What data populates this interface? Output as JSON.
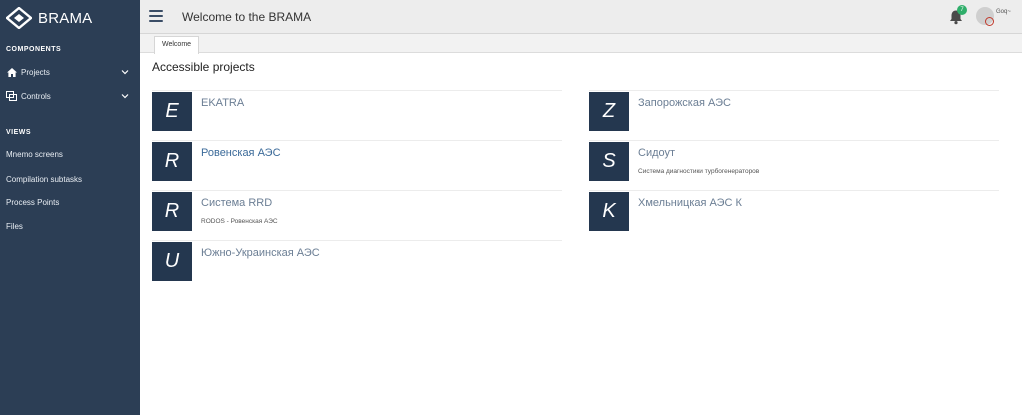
{
  "sidebar": {
    "brand": "BRAMA",
    "components_title": "COMPONENTS",
    "projects_label": "Projects",
    "controls_label": "Controls",
    "views_title": "VIEWS",
    "views": [
      "Mnemo screens",
      "Compilation subtasks",
      "Process Points",
      "Files"
    ]
  },
  "header": {
    "title": "Welcome to the BRAMA",
    "notification_count": "7",
    "user_name": "Goq~"
  },
  "tabs": [
    "Welcome"
  ],
  "main": {
    "title": "Accessible projects",
    "projects": [
      {
        "letter": "E",
        "name": "EKATRA",
        "desc": ""
      },
      {
        "letter": "Z",
        "name": "Запорожская АЭС",
        "desc": ""
      },
      {
        "letter": "R",
        "name": "Ровенская АЭС",
        "desc": ""
      },
      {
        "letter": "S",
        "name": "Сидоут",
        "desc": "Система диагностики турбогенераторов"
      },
      {
        "letter": "R",
        "name": "Система RRD",
        "desc": "RODOS - Ровенская АЭС"
      },
      {
        "letter": "K",
        "name": "Хмельницкая АЭС К",
        "desc": ""
      },
      {
        "letter": "U",
        "name": "Южно-Украинская АЭС",
        "desc": ""
      }
    ]
  },
  "colors": {
    "sidebar_bg": "#2c3e55",
    "tile_bg": "#24374f",
    "badge": "#2fae6a",
    "link": "#3b6a99"
  }
}
